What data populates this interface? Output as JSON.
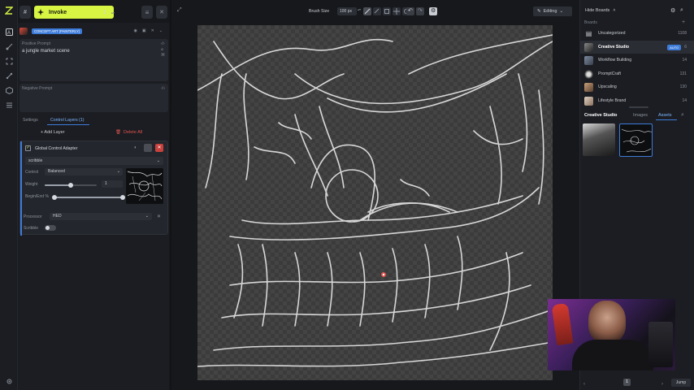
{
  "topbar": {
    "invoke_label": "Invoke",
    "iterations": "1"
  },
  "model": {
    "badge": "CONCEPT ART (PAINTERLY)"
  },
  "prompts": {
    "positive_label": "Positive Prompt",
    "positive_value": "a jungle market scene",
    "negative_label": "Negative Prompt"
  },
  "tabs": {
    "settings": "Settings",
    "control_layers": "Control Layers (1)"
  },
  "layer_actions": {
    "add": "+ Add Layer",
    "delete": "Delete All"
  },
  "adapter": {
    "title": "Global Control Adapter",
    "model": "scribble",
    "control_label": "Control",
    "control_value": "Balanced",
    "weight_label": "Weight",
    "weight_value": "1",
    "weight_fraction": 0.5,
    "begin_end_label": "Begin/End %",
    "processor_label": "Processor",
    "processor_value": "HED",
    "scribble_label": "Scribble"
  },
  "toolbar": {
    "brush_size_label": "Brush Size",
    "brush_size_value": "100 px",
    "mode": "Editing"
  },
  "boards": {
    "header": "Hide Boards",
    "section": "Boards",
    "items": [
      {
        "name": "Uncategorized",
        "count": "1108"
      },
      {
        "name": "Creative Studio",
        "badge": "AUTO",
        "count": "6"
      },
      {
        "name": "Workflow Building",
        "count": "14"
      },
      {
        "name": "PromptCraft",
        "count": "131"
      },
      {
        "name": "Upscaling",
        "count": "130"
      },
      {
        "name": "Lifestyle Brand",
        "count": "14"
      }
    ]
  },
  "gallery": {
    "board_title": "Creative Studio",
    "tab_images": "Images",
    "tab_assets": "Assets",
    "page": "1",
    "jump": "Jump"
  },
  "colors": {
    "accent": "#d7f542",
    "panel": "#1b1d22",
    "active_blue": "#3d7bd9",
    "danger": "#e0534f"
  }
}
